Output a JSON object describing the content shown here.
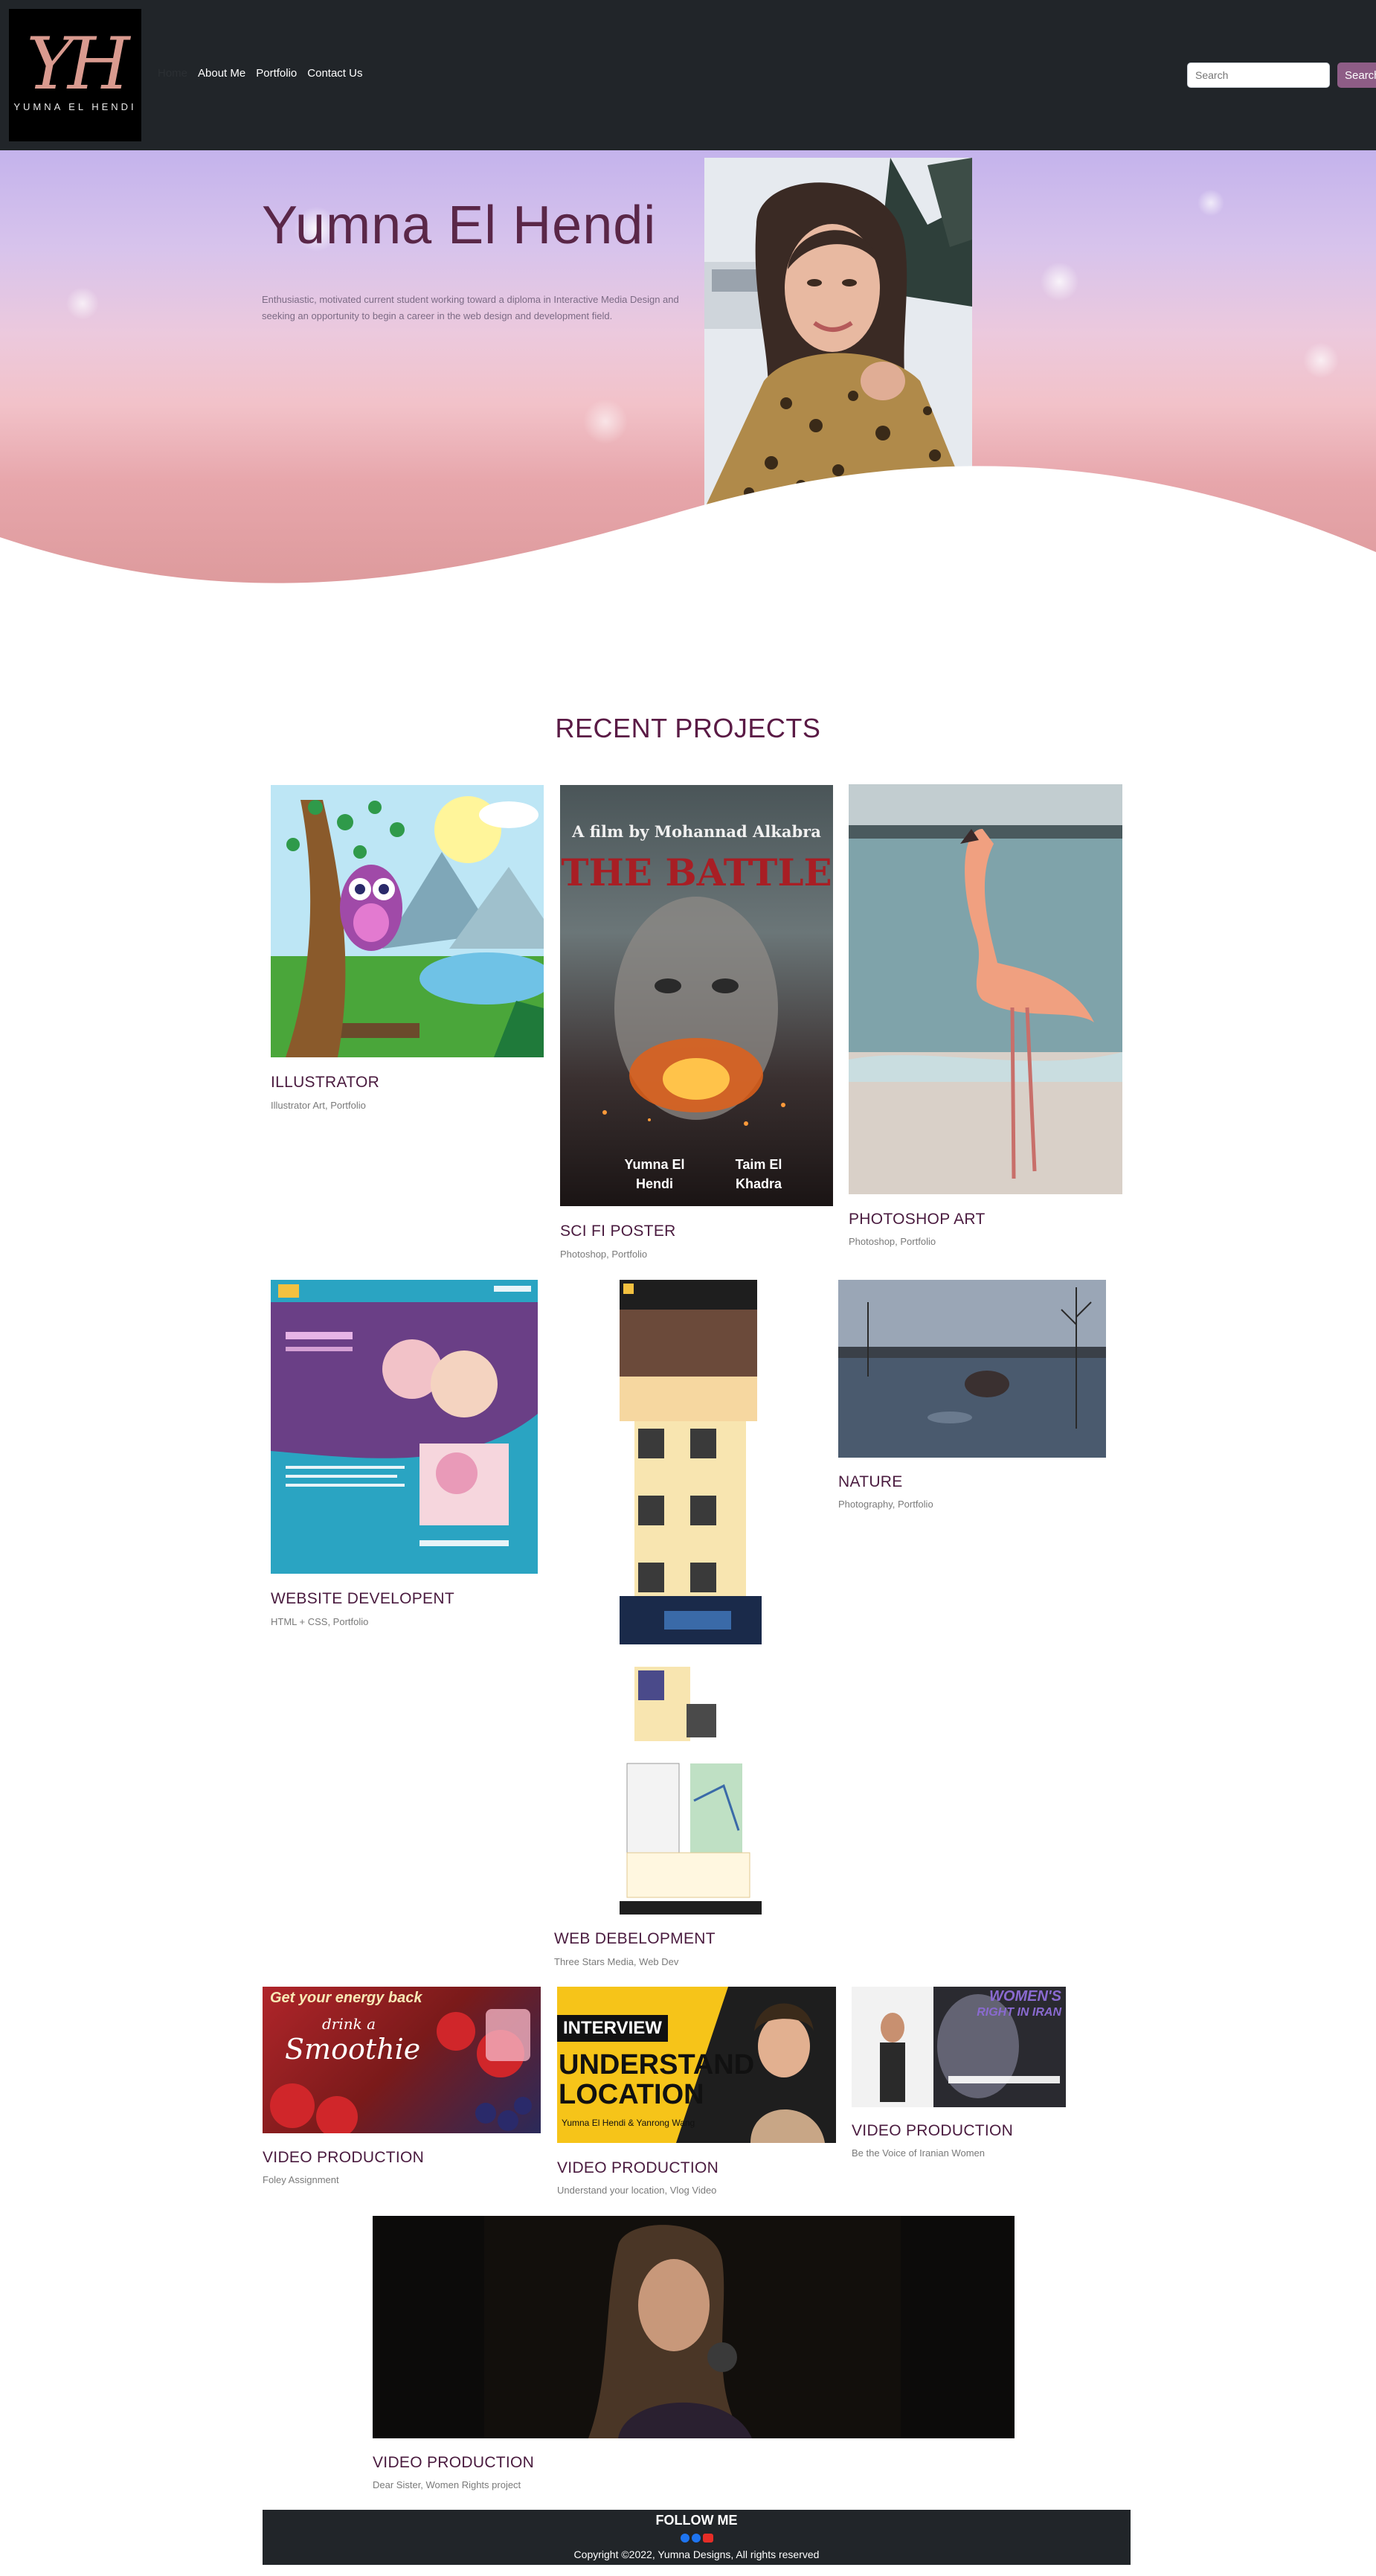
{
  "brand": {
    "monogram": "YH",
    "name": "YUMNA EL HENDI"
  },
  "nav": {
    "home": "Home",
    "about": "About Me",
    "portfolio": "Portfolio",
    "contact": "Contact Us"
  },
  "search": {
    "placeholder": "Search",
    "button": "Search"
  },
  "hero": {
    "title": "Yumna El Hendi",
    "text": "Enthusiastic, motivated current student working toward a diploma in Interactive Media Design and seeking an opportunity to begin a career in the web design and development field."
  },
  "projects": {
    "heading": "RECENT PROJECTS",
    "items": [
      {
        "title": "ILLUSTRATOR",
        "sub": "Illustrator Art, Portfolio"
      },
      {
        "title": "SCI FI POSTER",
        "sub": "Photoshop, Portfolio",
        "poster_top": "A film by Mohannad Alkabra",
        "poster_title": "THE BATTLE",
        "credit_left": "Yumna El Hendi",
        "credit_right": "Taim El Khadra"
      },
      {
        "title": "PHOTOSHOP ART",
        "sub": "Photoshop, Portfolio"
      },
      {
        "title": "WEBSITE DEVELOPENT",
        "sub": "HTML + CSS, Portfolio"
      },
      {
        "title": "WEB DEBELOPMENT",
        "sub": "Three Stars Media, Web Dev"
      },
      {
        "title": "NATURE",
        "sub": "Photography, Portfolio"
      },
      {
        "title": "VIDEO PRODUCTION",
        "sub": "Foley Assignment",
        "thumb_line1": "Get your energy back",
        "thumb_line2": "drink a",
        "thumb_line3": "Smoothie"
      },
      {
        "title": "VIDEO PRODUCTION",
        "sub": "Understand your location, Vlog Video",
        "thumb_line1": "INTERVIEW",
        "thumb_line2": "UNDERSTAND",
        "thumb_line3": "LOCATION",
        "thumb_credit": "Yumna El Hendi & Yanrong Wang"
      },
      {
        "title": "VIDEO PRODUCTION",
        "sub": "Be the Voice of Iranian Women",
        "thumb_line1": "WOMEN'S",
        "thumb_line2": "RIGHT IN IRAN"
      },
      {
        "title": "VIDEO PRODUCTION",
        "sub": "Dear Sister, Women Rights project"
      }
    ]
  },
  "footer": {
    "follow": "FOLLOW ME",
    "copyright": "Copyright ©2022, Yumna Designs, All rights reserved"
  },
  "colors": {
    "navbar": "#212529",
    "accent": "#8e5d86",
    "heading": "#5a1a45"
  }
}
